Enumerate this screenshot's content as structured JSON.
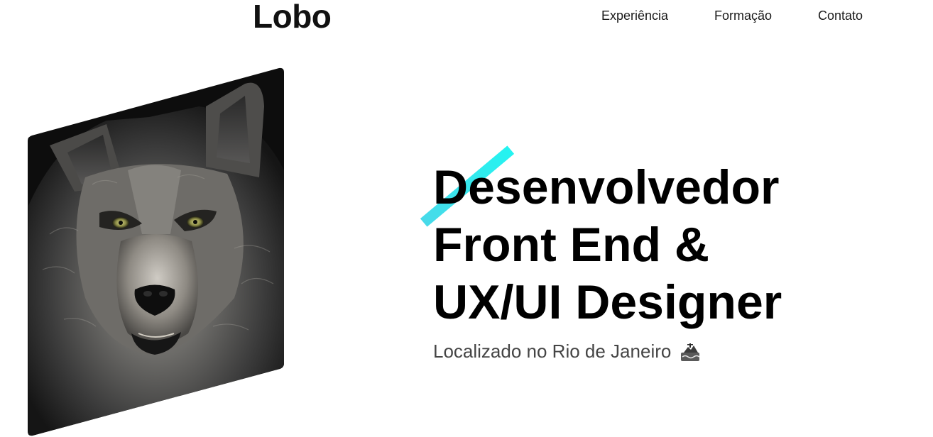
{
  "header": {
    "logo": "Lobo",
    "nav": [
      {
        "label": "Experiência"
      },
      {
        "label": "Formação"
      },
      {
        "label": "Contato"
      }
    ]
  },
  "hero": {
    "image_icon": "wolf-portrait-image",
    "headline": [
      "Desenvolvedor",
      "Front End &",
      "UX/UI Designer"
    ],
    "subtitle": "Localizado no Rio de Janeiro",
    "location_icon": "rio-landmark-icon",
    "accent_color": "#18f3f0"
  }
}
